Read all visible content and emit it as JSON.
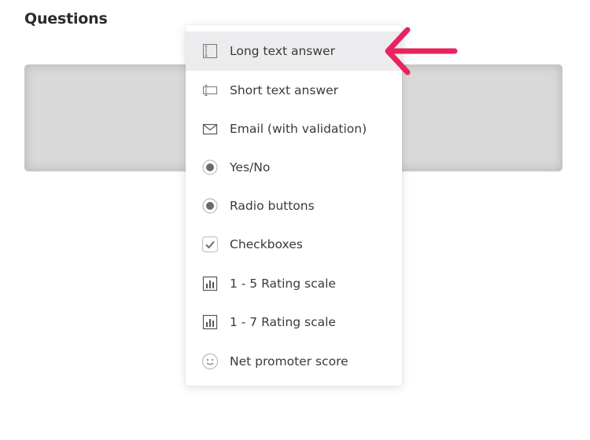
{
  "section": {
    "title": "Questions"
  },
  "menu": {
    "items": [
      {
        "label": "Long text answer",
        "icon": "long-text-icon"
      },
      {
        "label": "Short text answer",
        "icon": "short-text-icon"
      },
      {
        "label": "Email (with validation)",
        "icon": "envelope-icon"
      },
      {
        "label": "Yes/No",
        "icon": "radio-icon"
      },
      {
        "label": "Radio buttons",
        "icon": "radio-icon"
      },
      {
        "label": "Checkboxes",
        "icon": "checkbox-icon"
      },
      {
        "label": "1 - 5 Rating scale",
        "icon": "bar-chart-icon"
      },
      {
        "label": "1 - 7 Rating scale",
        "icon": "bar-chart-icon"
      },
      {
        "label": "Net promoter score",
        "icon": "smiley-icon"
      }
    ],
    "active_label": "Long text answer"
  },
  "colors": {
    "arrow": "#e8245f",
    "panel": "#d9d9d9",
    "active_item_bg": "#ececee",
    "text": "#3a3a3a",
    "icon": "#555555"
  }
}
